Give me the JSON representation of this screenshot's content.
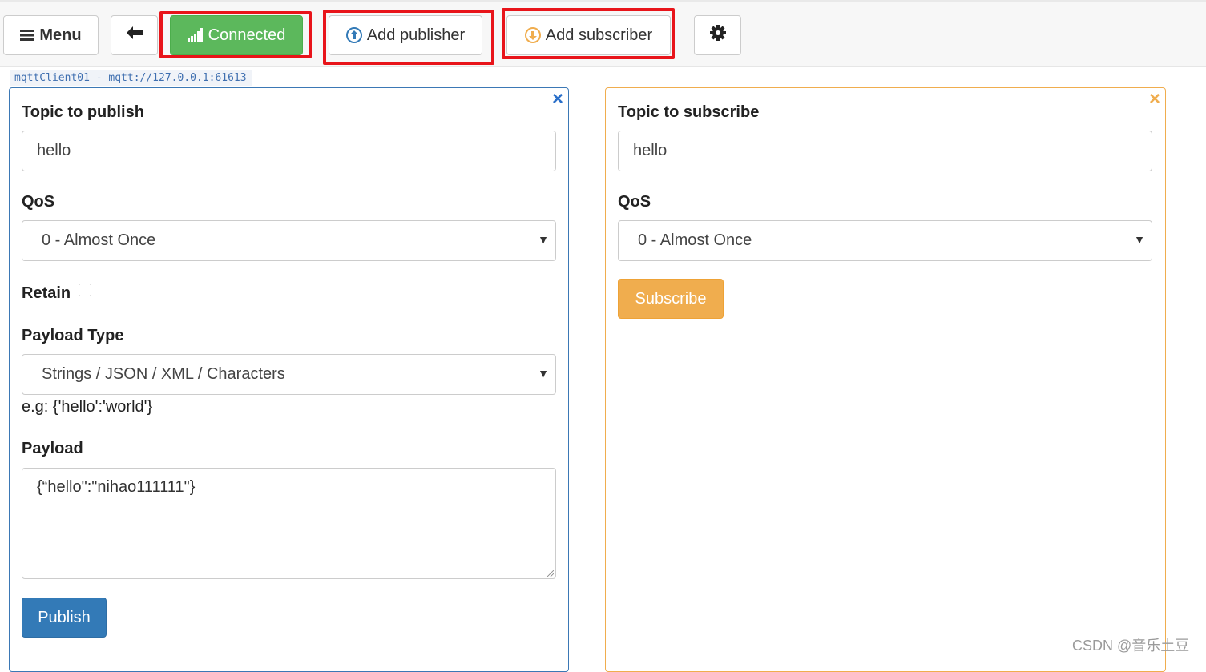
{
  "toolbar": {
    "menu_label": "Menu",
    "connected_label": "Connected",
    "add_publisher_label": "Add publisher",
    "add_subscriber_label": "Add subscriber",
    "icons": {
      "menu": "hamburger-icon",
      "back": "arrow-left-icon",
      "connected": "signal-bars-icon",
      "add_publisher": "circle-arrow-up-icon",
      "add_subscriber": "circle-arrow-down-icon",
      "settings": "gear-icon"
    }
  },
  "connection": {
    "label": "mqttClient01 - mqtt://127.0.0.1:61613"
  },
  "publisher": {
    "close_icon": "×",
    "topic_label": "Topic to publish",
    "topic_value": "hello",
    "qos_label": "QoS",
    "qos_value": "0 - Almost Once",
    "retain_label": "Retain",
    "retain_checked": false,
    "payload_type_label": "Payload Type",
    "payload_type_value": "Strings / JSON / XML / Characters",
    "payload_hint": "e.g: {'hello':'world'}",
    "payload_label": "Payload",
    "payload_value": "{“hello\":\"nihao111111\"}",
    "publish_button": "Publish"
  },
  "subscriber": {
    "close_icon": "×",
    "topic_label": "Topic to subscribe",
    "topic_value": "hello",
    "qos_label": "QoS",
    "qos_value": "0 - Almost Once",
    "subscribe_button": "Subscribe"
  },
  "watermark": "CSDN @音乐土豆",
  "colors": {
    "connected": "#5cb85c",
    "primary": "#337ab7",
    "warning": "#f0ad4e",
    "highlight": "#e8141a"
  }
}
